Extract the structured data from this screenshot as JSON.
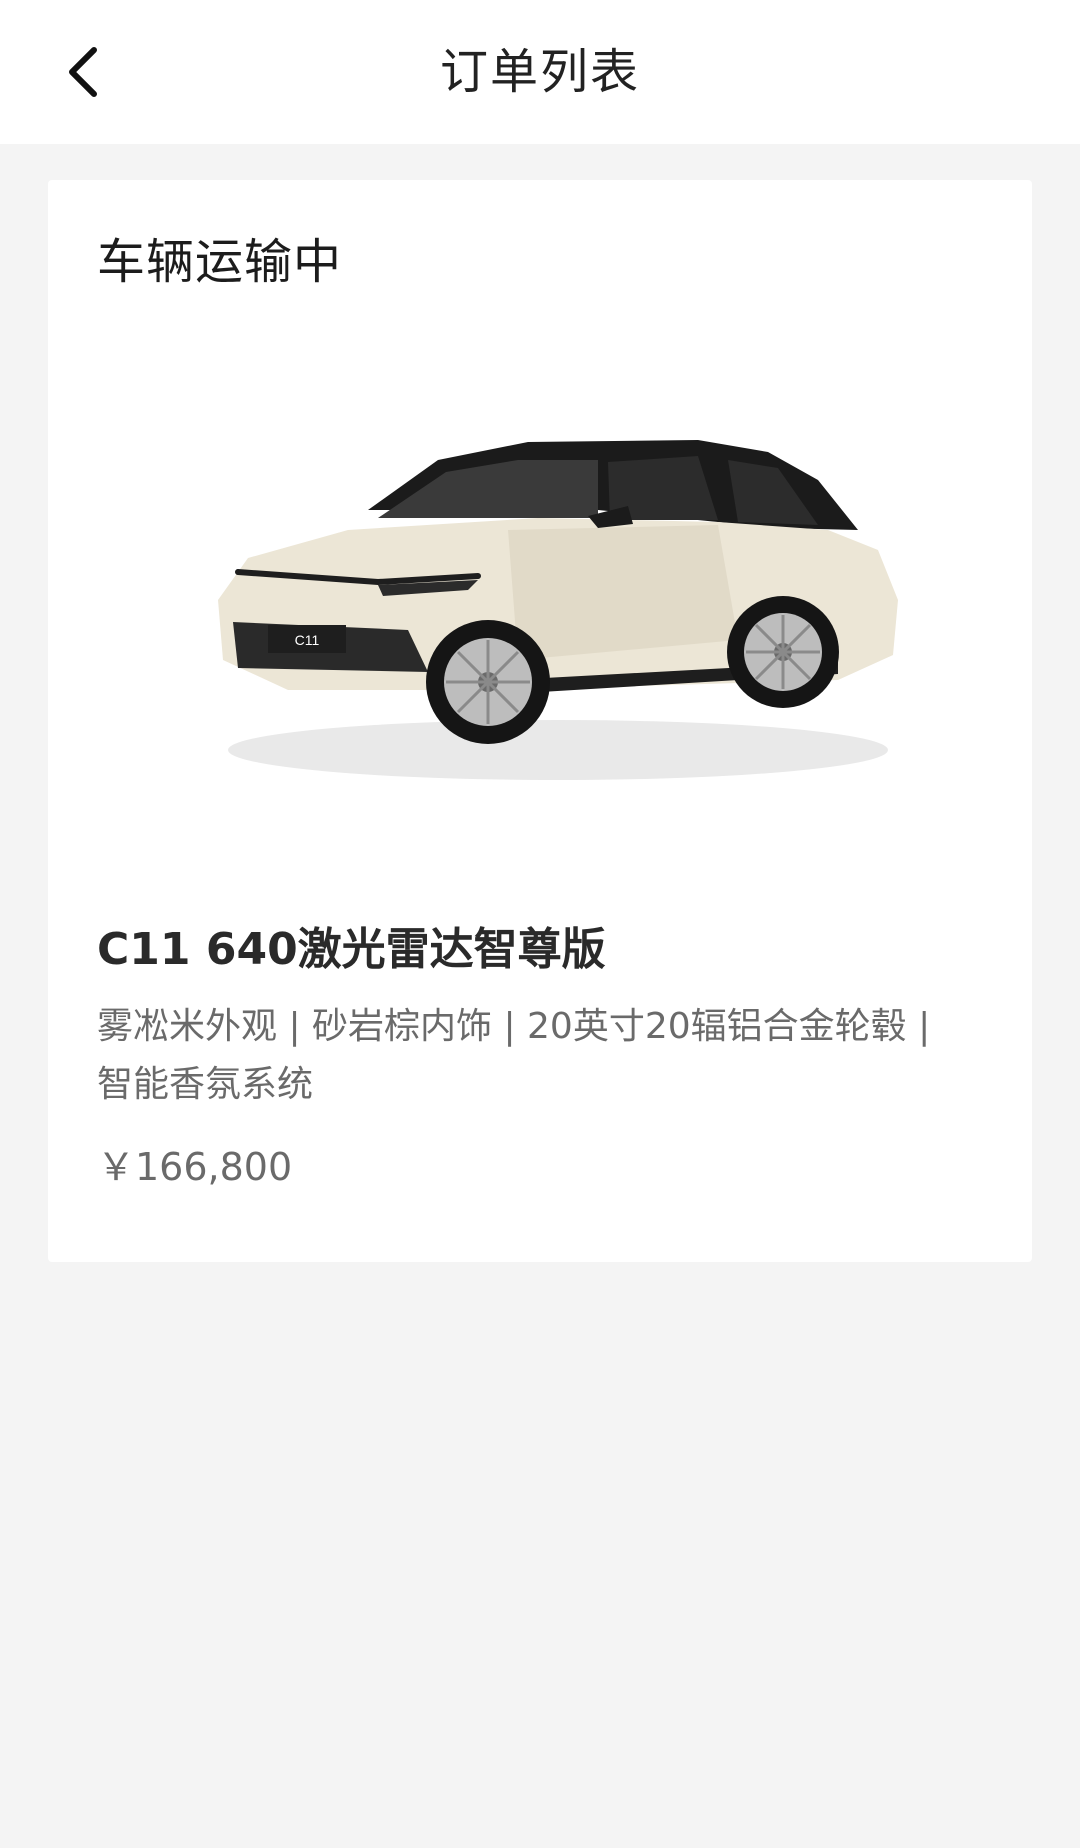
{
  "header": {
    "title": "订单列表"
  },
  "order": {
    "status": "车辆运输中",
    "car_name": "C11 640激光雷达智尊版",
    "config": "雾凇米外观 | 砂岩棕内饰 | 20英寸20辐铝合金轮毂 | 智能香氛系统",
    "price": "￥166,800",
    "plate_text": "C11"
  },
  "icons": {
    "back": "chevron-left-icon"
  },
  "colors": {
    "background": "#f4f4f4",
    "card": "#ffffff",
    "title_text": "#222222",
    "secondary_text": "#6a6a6a",
    "car_body": "#ece6d6"
  }
}
